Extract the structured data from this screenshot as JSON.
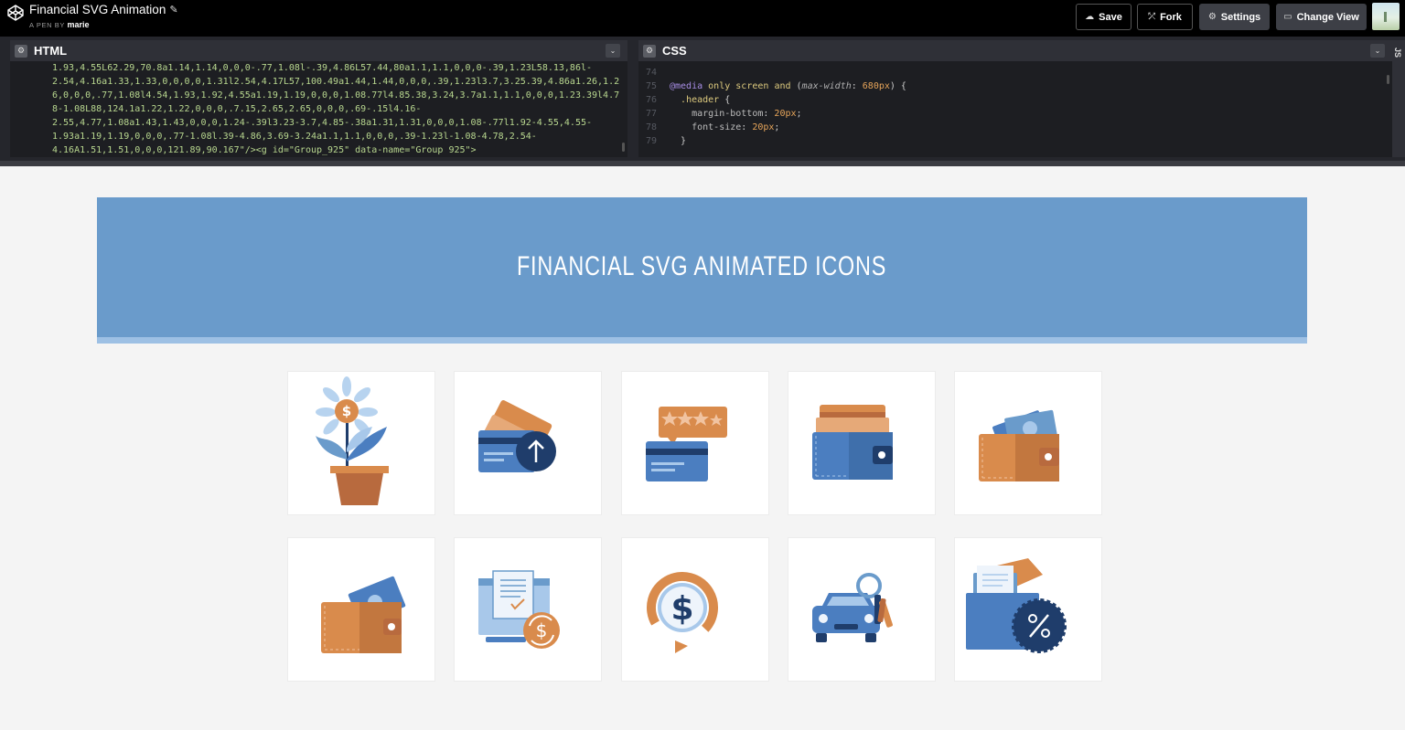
{
  "topbar": {
    "title": "Financial SVG Animation",
    "byline_prefix": "A PEN BY",
    "author": "marie",
    "buttons": {
      "save": "Save",
      "fork": "Fork",
      "settings": "Settings",
      "change_view": "Change View"
    }
  },
  "editors": {
    "html": {
      "title": "HTML",
      "lines": [
        "1.93,4.55L62.29,70.8a1.14,1.14,0,0,0-.77,1.08l-.39,4.86L57.44,80a1.1,1.1,0,0,0-.39,1.23L58.13,86l-",
        "2.54,4.16a1.33,1.33,0,0,0,0,1.31l2.54,4.17L57,100.49a1.44,1.44,0,0,0,.39,1.23l3.7,3.25.39,4.86a1.26,1.2",
        "6,0,0,0,.77,1.08l4.54,1.93,1.92,4.55a1.19,1.19,0,0,0,1.08.77l4.85.38,3.24,3.7a1.1,1.1,0,0,0,1.23.39l4.7",
        "8-1.08L88,124.1a1.22,1.22,0,0,0,.7.15,2.65,2.65,0,0,0,.69-.15l4.16-",
        "2.55,4.77,1.08a1.43,1.43,0,0,0,1.24-.39l3.23-3.7,4.85-.38a1.31,1.31,0,0,0,1.08-.77l1.92-4.55,4.55-",
        "1.93a1.19,1.19,0,0,0,.77-1.08l.39-4.86,3.69-3.24a1.1,1.1,0,0,0,.39-1.23l-1.08-4.78,2.54-",
        "4.16A1.51,1.51,0,0,0,121.89,90.167\"/><g id=\"Group_925\" data-name=\"Group 925\">"
      ]
    },
    "css": {
      "title": "CSS",
      "lines": [
        {
          "num": "74",
          "text": ""
        },
        {
          "num": "75",
          "media": "@media",
          "only": "only",
          "screen": "screen",
          "and": "and",
          "feature": "max-width",
          "value": "680px"
        },
        {
          "num": "76",
          "selector": ".header",
          "brace": "{"
        },
        {
          "num": "77",
          "prop": "margin-bottom",
          "val": "20px"
        },
        {
          "num": "78",
          "prop": "font-size",
          "val": "20px"
        },
        {
          "num": "79",
          "close": "}"
        }
      ]
    },
    "js_tab": "JS"
  },
  "preview": {
    "header_title": "FINANCIAL SVG ANIMATED ICONS",
    "colors": {
      "header_bg": "#6a9bcb",
      "header_border": "#9dc0e4",
      "blue": "#4b7ec0",
      "dark_blue": "#1f3d6b",
      "light_blue": "#a8c8ea",
      "orange": "#d98b4c",
      "dark_orange": "#b86a3e"
    },
    "icons": [
      "money-plant-icon",
      "card-upload-icon",
      "card-rating-icon",
      "wallet-cards-icon",
      "wallet-cash-icon",
      "wallet-bill-icon",
      "invoice-exchange-icon",
      "dollar-refresh-icon",
      "car-key-icon",
      "folder-discount-icon"
    ]
  }
}
